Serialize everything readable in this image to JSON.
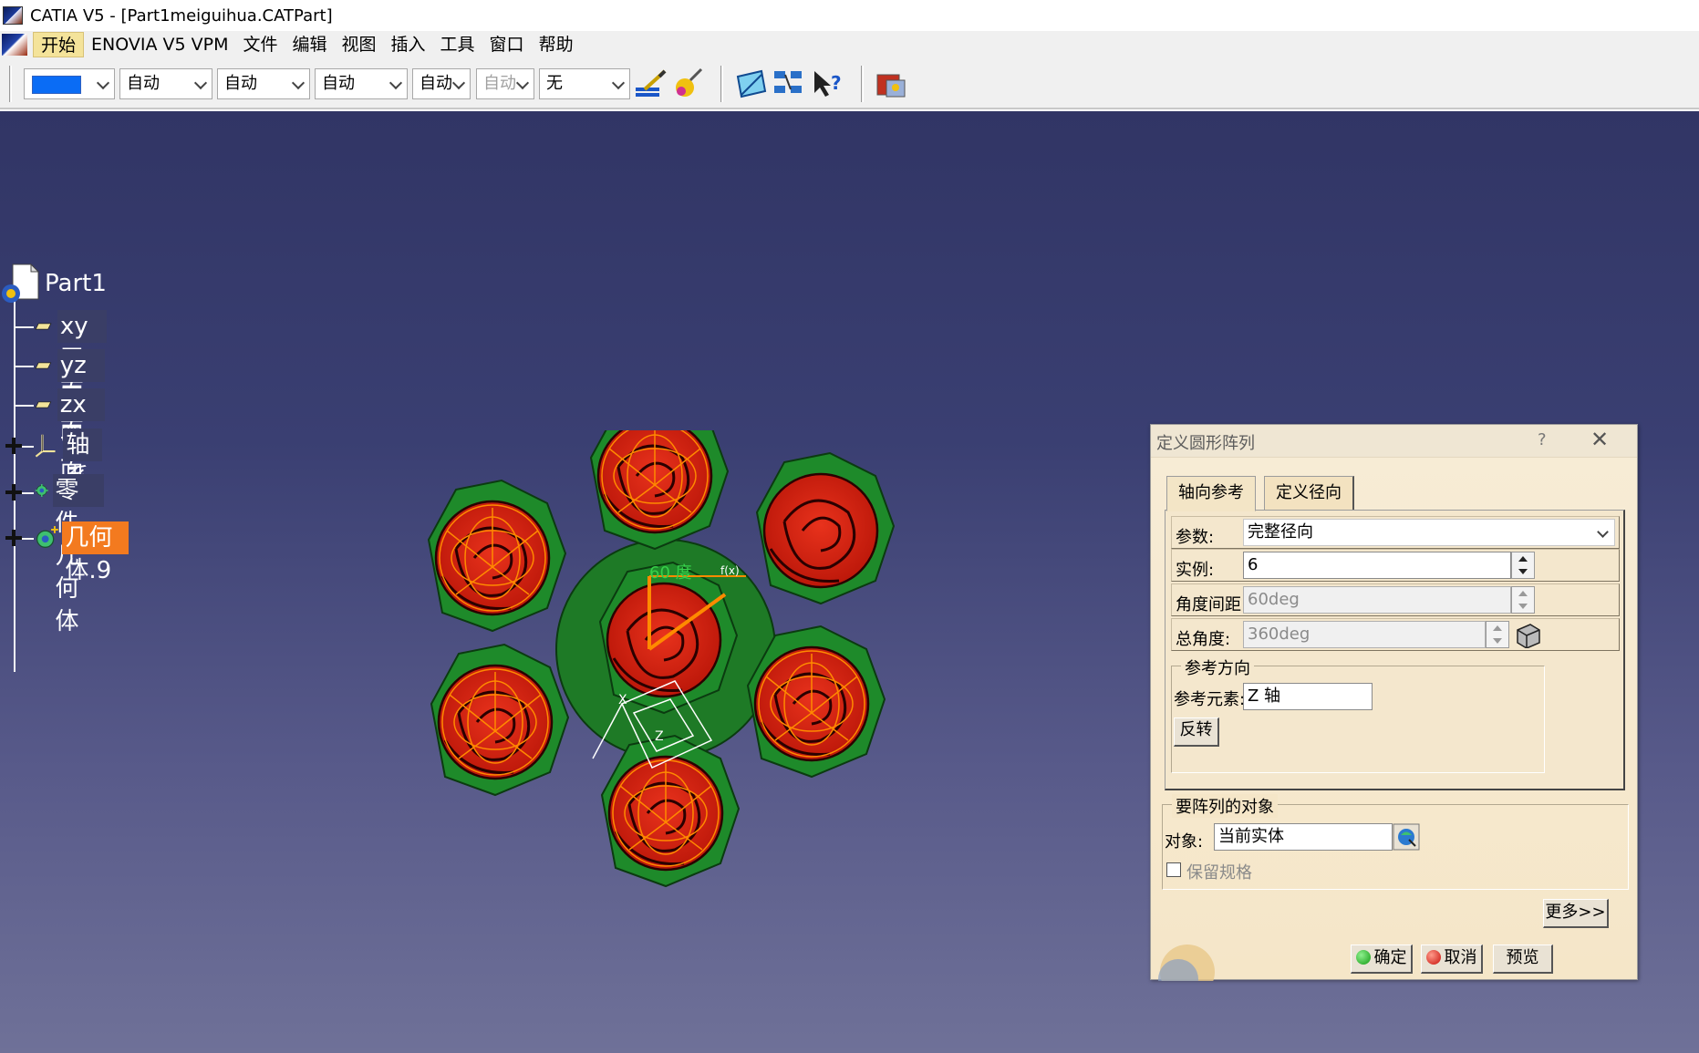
{
  "window": {
    "title": "CATIA V5 - [Part1meiguihua.CATPart]"
  },
  "menubar": {
    "items": [
      "开始",
      "ENOVIA V5 VPM",
      "文件",
      "编辑",
      "视图",
      "插入",
      "工具",
      "窗口",
      "帮助"
    ]
  },
  "toolbar": {
    "color_value": "#0a6cf5",
    "combos": [
      "自动",
      "自动",
      "自动",
      "自动",
      "自动",
      "无"
    ],
    "icons": [
      "paint-brush-icon",
      "apply-material-icon",
      "sketch-plane-icon",
      "tree-structure-icon",
      "whats-this-help-icon",
      "catalog-browser-icon"
    ]
  },
  "tree": {
    "root": "Part1",
    "nodes": [
      {
        "label": "xy 平面",
        "icon": "plane-icon",
        "expandable": false
      },
      {
        "label": "yz 平面",
        "icon": "plane-icon",
        "expandable": false
      },
      {
        "label": "zx 平面",
        "icon": "plane-icon",
        "expandable": false
      },
      {
        "label": "轴系",
        "icon": "axis-system-icon",
        "expandable": true
      },
      {
        "label": "零件几何体",
        "icon": "part-body-icon",
        "expandable": true
      },
      {
        "label": "几何体.9",
        "icon": "body-icon",
        "expandable": true,
        "selected": true
      }
    ]
  },
  "viewport": {
    "annotation": "60 度",
    "annotation_fx": "f(x)",
    "axis_labels": {
      "x": "X",
      "z": "Z"
    },
    "colors": {
      "petal": "#d41e10",
      "leaf": "#1e8a2a",
      "wire": "#ff8a00"
    }
  },
  "dialog": {
    "title": "定义圆形阵列",
    "help": "?",
    "close": "✕",
    "tabs": [
      "轴向参考",
      "定义径向"
    ],
    "fields": {
      "params_label": "参数:",
      "params_value": "完整径向",
      "instances_label": "实例:",
      "instances_value": "6",
      "spacing_label": "角度间距:",
      "spacing_value": "60deg",
      "total_label": "总角度:",
      "total_value": "360deg"
    },
    "ref_direction": {
      "legend": "参考方向",
      "element_label": "参考元素:",
      "element_value": "Z 轴",
      "reverse": "反转"
    },
    "objects": {
      "legend": "要阵列的对象",
      "object_label": "对象:",
      "object_value": "当前实体",
      "keep_spec": "保留规格",
      "keep_spec_checked": false
    },
    "buttons": {
      "more": "更多>>",
      "ok": "确定",
      "cancel": "取消",
      "preview": "预览"
    }
  }
}
